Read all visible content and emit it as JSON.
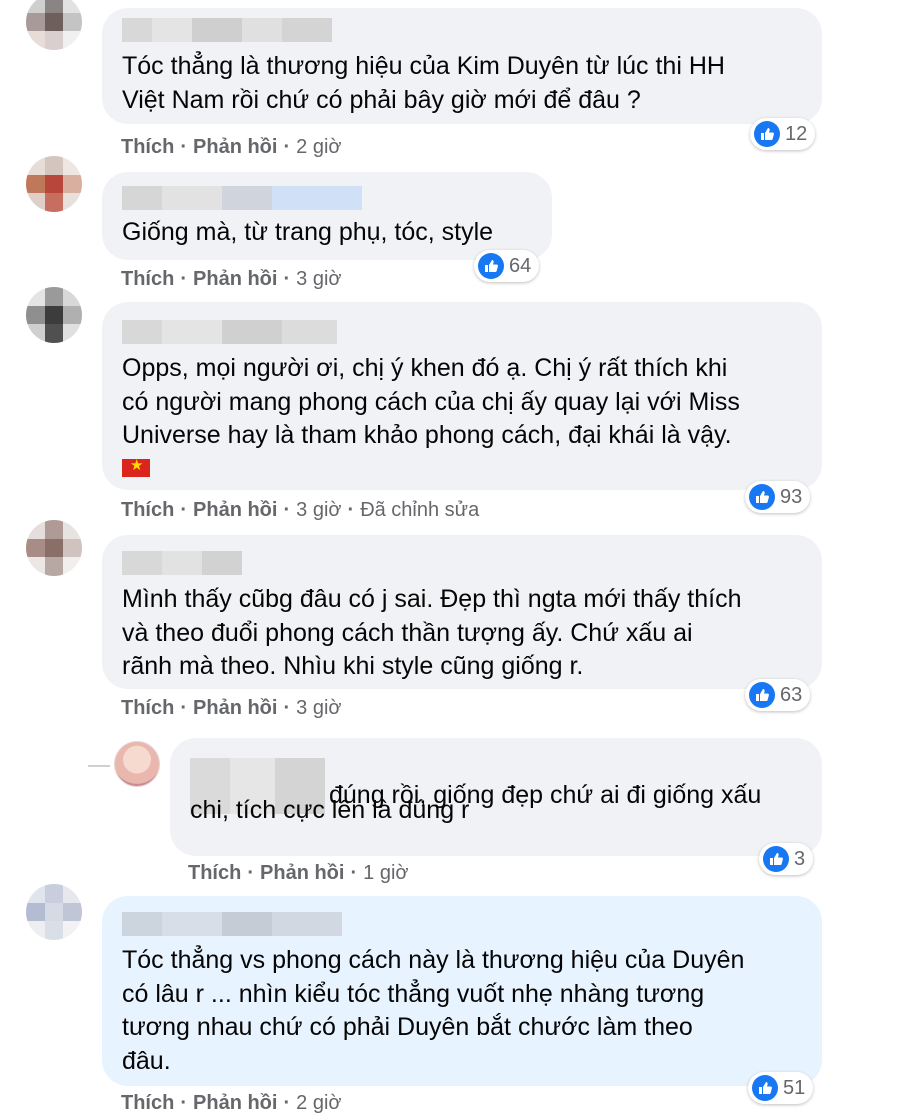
{
  "actions": {
    "like": "Thích",
    "reply": "Phản hồi",
    "separator": "·"
  },
  "comments": [
    {
      "text": "Tóc thẳng là thương hiệu của Kim Duyên từ lúc thi HH\nViệt Nam rồi chứ có phải bây giờ mới để đâu ?",
      "time": "2 giờ",
      "reactions": "12",
      "edited": ""
    },
    {
      "text": "Giống mà, từ trang phụ, tóc, style",
      "time": "3 giờ",
      "reactions": "64",
      "edited": ""
    },
    {
      "text": "Opps, mọi người ơi, chị ý khen đó ạ. Chị ý rất thích khi\ncó người mang phong cách của chị ấy quay lại với Miss\nUniverse hay là tham khảo phong cách, đại khái là vậy.",
      "time": "3 giờ",
      "reactions": "93",
      "edited": "Đã chỉnh sửa",
      "flag": "vietnam-flag"
    },
    {
      "text": "Mình thấy cũbg đâu có j sai. Đẹp thì ngta mới thấy thích\nvà theo đuổi phong cách thần tượng ấy. Chứ xấu ai\nrãnh mà theo. Nhìu khi style cũng giống r.",
      "time": "3 giờ",
      "reactions": "63",
      "edited": ""
    },
    {
      "text_line1": "đúng rồi, giống đẹp chứ ai đi giống xấu",
      "text_line2": "chi, tích cực lên là đúng r",
      "time": "1 giờ",
      "reactions": "3",
      "edited": ""
    },
    {
      "text": "Tóc thẳng vs phong cách này là thương hiệu của Duyên\ncó lâu r ... nhìn kiểu tóc thẳng vuốt nhẹ nhàng tương\ntương nhau chứ có phải Duyên bắt chước làm theo\nđâu.",
      "time": "2 giờ",
      "reactions": "51",
      "edited": ""
    }
  ],
  "colors": {
    "bubble": "#f0f2f5",
    "bubble_highlight": "#e7f3ff",
    "like_blue": "#1877f2",
    "meta": "#65676b"
  }
}
